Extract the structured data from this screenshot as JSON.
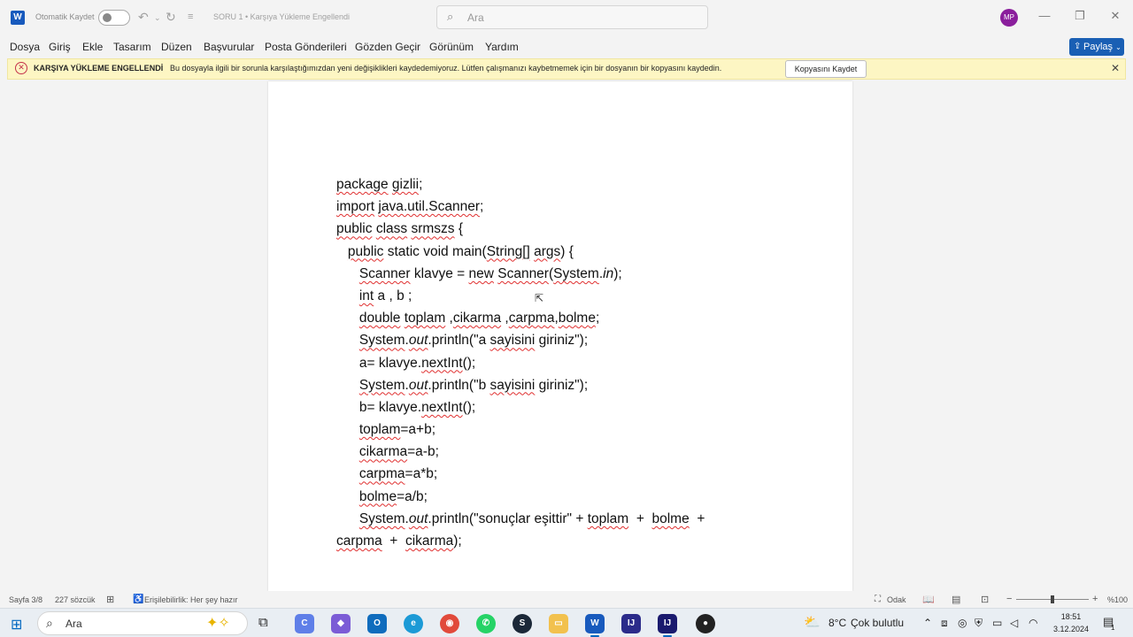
{
  "titlebar": {
    "app_icon": "word-icon",
    "autosave_label": "Otomatik Kaydet",
    "doc_title": "SORU 1 • Karşıya Yükleme Engellendi",
    "search_placeholder": "Ara",
    "avatar_initials": "MP"
  },
  "menu": {
    "items": [
      "Dosya",
      "Giriş",
      "Ekle",
      "Tasarım",
      "Düzen",
      "Başvurular",
      "Posta Gönderileri",
      "Gözden Geçir",
      "Görünüm",
      "Yardım"
    ],
    "share_label": "Paylaş"
  },
  "message_bar": {
    "title": "KARŞIYA YÜKLEME ENGELLENDİ",
    "text": "Bu dosyayla ilgili bir sorunla karşılaştığımızdan yeni değişiklikleri kaydedemiyoruz. Lütfen çalışmanızı kaybetmemek için bir dosyanın bir kopyasını kaydedin.",
    "button_label": "Kopyasını Kaydet"
  },
  "document": {
    "code_lines": [
      "package gizlii;",
      "import java.util.Scanner;",
      "public class srmszs {",
      "   public static void main(String[] args) {",
      "      Scanner klavye = new Scanner(System.in);",
      "      int a , b ;",
      "      double toplam ,cikarma ,carpma,bolme;",
      "      System.out.println(\"a sayisini giriniz\");",
      "      a= klavye.nextInt();",
      "      System.out.println(\"b sayisini giriniz\");",
      "      b= klavye.nextInt();",
      "      toplam=a+b;",
      "      cikarma=a-b;",
      "      carpma=a*b;",
      "      bolme=a/b;",
      "      System.out.println(\"sonuçlar eşittir\" + toplam  +  bolme  +",
      "carpma  +  cikarma);"
    ]
  },
  "status": {
    "page": "Sayfa 3/8",
    "words": "227 sözcük",
    "accessibility": "Erişilebilirlik: Her şey hazır",
    "focus": "Odak",
    "zoom": "%100",
    "zoom_level": 1.0
  },
  "taskbar": {
    "search_placeholder": "Ara",
    "weather_temp": "8°C",
    "weather_desc": "Çok bulutlu",
    "time": "18:51",
    "date": "3.12.2024",
    "notification_count": "1"
  },
  "colors": {
    "word_blue": "#185abd",
    "share_blue": "#1a5fb4",
    "msgbar_bg": "#fdf6c3",
    "error_red": "#c4314b"
  }
}
